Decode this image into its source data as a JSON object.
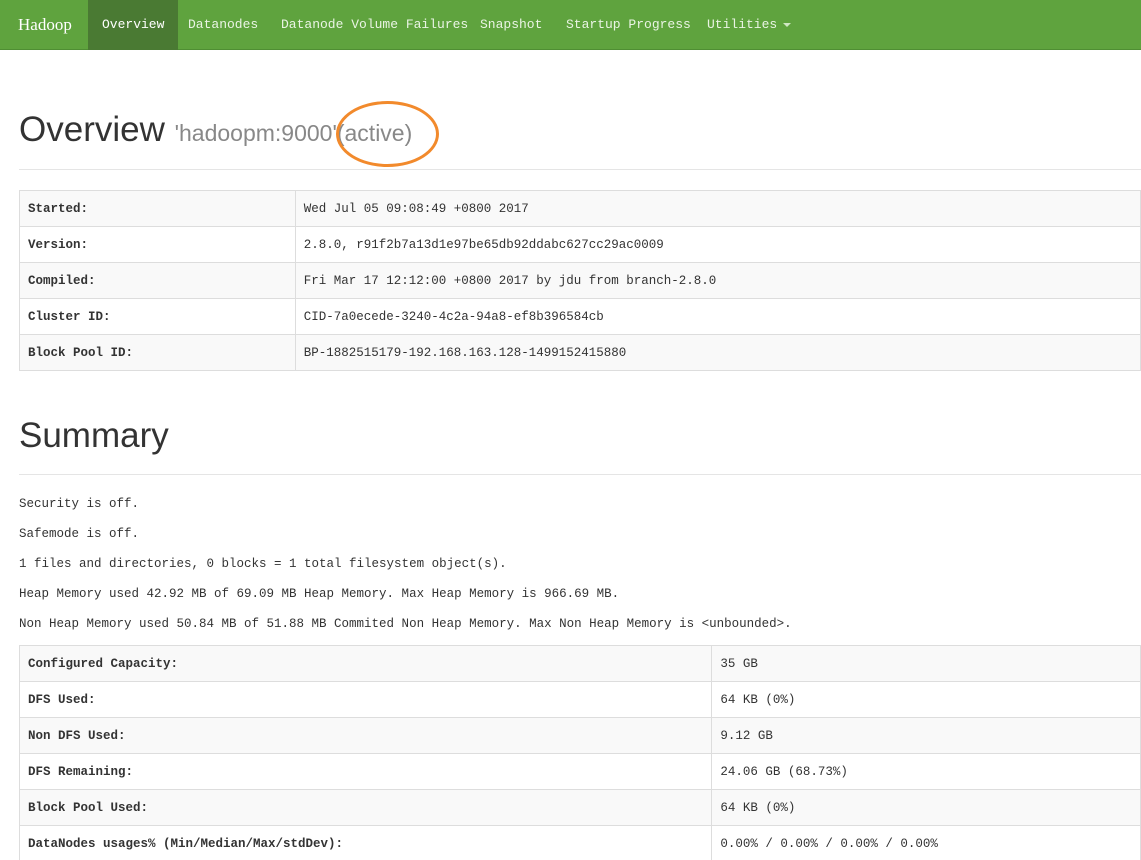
{
  "nav": {
    "brand": "Hadoop",
    "items": [
      {
        "label": "Overview"
      },
      {
        "label": "Datanodes"
      },
      {
        "label": "Datanode Volume Failures"
      },
      {
        "label": "Snapshot"
      },
      {
        "label": "Startup Progress"
      },
      {
        "label": "Utilities"
      }
    ]
  },
  "overview": {
    "title": "Overview",
    "host": "'hadoopm:9000'",
    "state": "(active)",
    "rows": [
      {
        "key": "Started:",
        "value": "Wed Jul 05 09:08:49 +0800 2017"
      },
      {
        "key": "Version:",
        "value": "2.8.0, r91f2b7a13d1e97be65db92ddabc627cc29ac0009"
      },
      {
        "key": "Compiled:",
        "value": "Fri Mar 17 12:12:00 +0800 2017 by jdu from branch-2.8.0"
      },
      {
        "key": "Cluster ID:",
        "value": "CID-7a0ecede-3240-4c2a-94a8-ef8b396584cb"
      },
      {
        "key": "Block Pool ID:",
        "value": "BP-1882515179-192.168.163.128-1499152415880"
      }
    ]
  },
  "summary": {
    "title": "Summary",
    "lines": [
      "Security is off.",
      "Safemode is off.",
      "1 files and directories, 0 blocks = 1 total filesystem object(s).",
      "Heap Memory used 42.92 MB of 69.09 MB Heap Memory. Max Heap Memory is 966.69 MB.",
      "Non Heap Memory used 50.84 MB of 51.88 MB Commited Non Heap Memory. Max Non Heap Memory is <unbounded>."
    ],
    "rows": [
      {
        "key": "Configured Capacity:",
        "value": "35 GB"
      },
      {
        "key": "DFS Used:",
        "value": "64 KB (0%)"
      },
      {
        "key": "Non DFS Used:",
        "value": "9.12 GB"
      },
      {
        "key": "DFS Remaining:",
        "value": "24.06 GB (68.73%)"
      },
      {
        "key": "Block Pool Used:",
        "value": "64 KB (0%)"
      },
      {
        "key": "DataNodes usages% (Min/Median/Max/stdDev):",
        "value": "0.00% / 0.00% / 0.00% / 0.00%"
      }
    ]
  },
  "colors": {
    "navbar": "#5fa33e",
    "navbar_active": "#4a7a33",
    "highlight_circle": "#f28a2c"
  }
}
